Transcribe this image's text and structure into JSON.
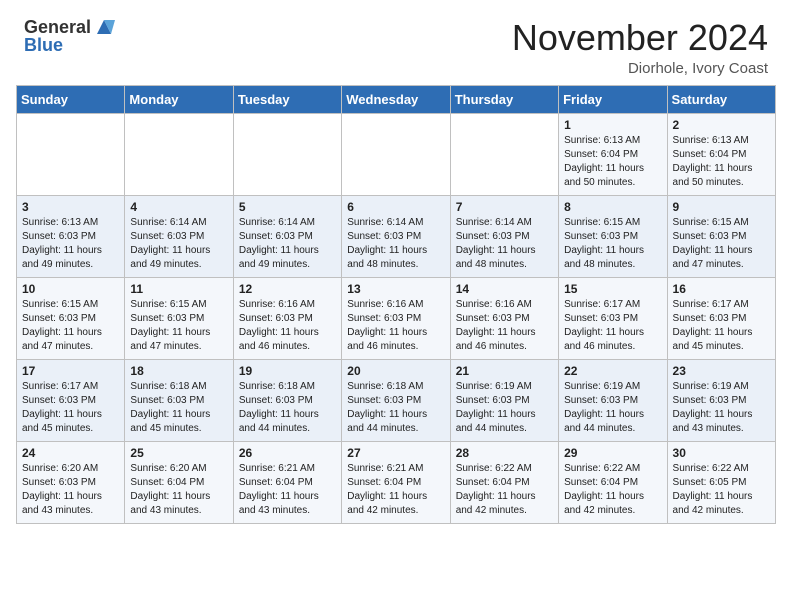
{
  "header": {
    "logo_line1": "General",
    "logo_line2": "Blue",
    "month": "November 2024",
    "location": "Diorhole, Ivory Coast"
  },
  "weekdays": [
    "Sunday",
    "Monday",
    "Tuesday",
    "Wednesday",
    "Thursday",
    "Friday",
    "Saturday"
  ],
  "weeks": [
    [
      {
        "day": "",
        "info": ""
      },
      {
        "day": "",
        "info": ""
      },
      {
        "day": "",
        "info": ""
      },
      {
        "day": "",
        "info": ""
      },
      {
        "day": "",
        "info": ""
      },
      {
        "day": "1",
        "info": "Sunrise: 6:13 AM\nSunset: 6:04 PM\nDaylight: 11 hours\nand 50 minutes."
      },
      {
        "day": "2",
        "info": "Sunrise: 6:13 AM\nSunset: 6:04 PM\nDaylight: 11 hours\nand 50 minutes."
      }
    ],
    [
      {
        "day": "3",
        "info": "Sunrise: 6:13 AM\nSunset: 6:03 PM\nDaylight: 11 hours\nand 49 minutes."
      },
      {
        "day": "4",
        "info": "Sunrise: 6:14 AM\nSunset: 6:03 PM\nDaylight: 11 hours\nand 49 minutes."
      },
      {
        "day": "5",
        "info": "Sunrise: 6:14 AM\nSunset: 6:03 PM\nDaylight: 11 hours\nand 49 minutes."
      },
      {
        "day": "6",
        "info": "Sunrise: 6:14 AM\nSunset: 6:03 PM\nDaylight: 11 hours\nand 48 minutes."
      },
      {
        "day": "7",
        "info": "Sunrise: 6:14 AM\nSunset: 6:03 PM\nDaylight: 11 hours\nand 48 minutes."
      },
      {
        "day": "8",
        "info": "Sunrise: 6:15 AM\nSunset: 6:03 PM\nDaylight: 11 hours\nand 48 minutes."
      },
      {
        "day": "9",
        "info": "Sunrise: 6:15 AM\nSunset: 6:03 PM\nDaylight: 11 hours\nand 47 minutes."
      }
    ],
    [
      {
        "day": "10",
        "info": "Sunrise: 6:15 AM\nSunset: 6:03 PM\nDaylight: 11 hours\nand 47 minutes."
      },
      {
        "day": "11",
        "info": "Sunrise: 6:15 AM\nSunset: 6:03 PM\nDaylight: 11 hours\nand 47 minutes."
      },
      {
        "day": "12",
        "info": "Sunrise: 6:16 AM\nSunset: 6:03 PM\nDaylight: 11 hours\nand 46 minutes."
      },
      {
        "day": "13",
        "info": "Sunrise: 6:16 AM\nSunset: 6:03 PM\nDaylight: 11 hours\nand 46 minutes."
      },
      {
        "day": "14",
        "info": "Sunrise: 6:16 AM\nSunset: 6:03 PM\nDaylight: 11 hours\nand 46 minutes."
      },
      {
        "day": "15",
        "info": "Sunrise: 6:17 AM\nSunset: 6:03 PM\nDaylight: 11 hours\nand 46 minutes."
      },
      {
        "day": "16",
        "info": "Sunrise: 6:17 AM\nSunset: 6:03 PM\nDaylight: 11 hours\nand 45 minutes."
      }
    ],
    [
      {
        "day": "17",
        "info": "Sunrise: 6:17 AM\nSunset: 6:03 PM\nDaylight: 11 hours\nand 45 minutes."
      },
      {
        "day": "18",
        "info": "Sunrise: 6:18 AM\nSunset: 6:03 PM\nDaylight: 11 hours\nand 45 minutes."
      },
      {
        "day": "19",
        "info": "Sunrise: 6:18 AM\nSunset: 6:03 PM\nDaylight: 11 hours\nand 44 minutes."
      },
      {
        "day": "20",
        "info": "Sunrise: 6:18 AM\nSunset: 6:03 PM\nDaylight: 11 hours\nand 44 minutes."
      },
      {
        "day": "21",
        "info": "Sunrise: 6:19 AM\nSunset: 6:03 PM\nDaylight: 11 hours\nand 44 minutes."
      },
      {
        "day": "22",
        "info": "Sunrise: 6:19 AM\nSunset: 6:03 PM\nDaylight: 11 hours\nand 44 minutes."
      },
      {
        "day": "23",
        "info": "Sunrise: 6:19 AM\nSunset: 6:03 PM\nDaylight: 11 hours\nand 43 minutes."
      }
    ],
    [
      {
        "day": "24",
        "info": "Sunrise: 6:20 AM\nSunset: 6:03 PM\nDaylight: 11 hours\nand 43 minutes."
      },
      {
        "day": "25",
        "info": "Sunrise: 6:20 AM\nSunset: 6:04 PM\nDaylight: 11 hours\nand 43 minutes."
      },
      {
        "day": "26",
        "info": "Sunrise: 6:21 AM\nSunset: 6:04 PM\nDaylight: 11 hours\nand 43 minutes."
      },
      {
        "day": "27",
        "info": "Sunrise: 6:21 AM\nSunset: 6:04 PM\nDaylight: 11 hours\nand 42 minutes."
      },
      {
        "day": "28",
        "info": "Sunrise: 6:22 AM\nSunset: 6:04 PM\nDaylight: 11 hours\nand 42 minutes."
      },
      {
        "day": "29",
        "info": "Sunrise: 6:22 AM\nSunset: 6:04 PM\nDaylight: 11 hours\nand 42 minutes."
      },
      {
        "day": "30",
        "info": "Sunrise: 6:22 AM\nSunset: 6:05 PM\nDaylight: 11 hours\nand 42 minutes."
      }
    ]
  ]
}
